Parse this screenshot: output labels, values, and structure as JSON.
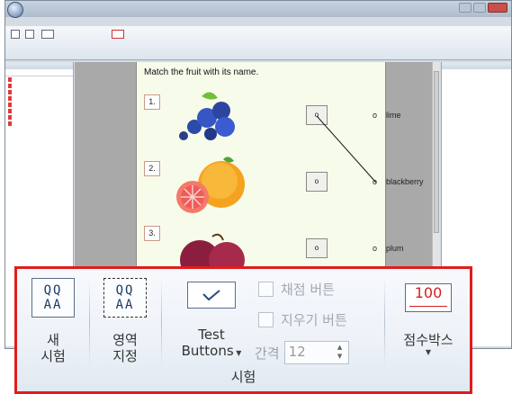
{
  "ribbon_group": {
    "label": "시험",
    "new_exam": {
      "line1": "새",
      "line2": "시험",
      "icon_text": [
        "QQ",
        "AA"
      ]
    },
    "area_select": {
      "line1": "영역",
      "line2": "지정",
      "icon_text": [
        "QQ",
        "AA"
      ]
    },
    "test_buttons": {
      "line1": "Test",
      "line2": "Buttons"
    },
    "grade_button": {
      "label": "채점 버튼"
    },
    "clear_button": {
      "label": "지우기 버튼"
    },
    "spacing": {
      "label": "간격",
      "value": "12"
    },
    "score_box": {
      "label": "점수박스",
      "icon_text": "100"
    }
  },
  "document": {
    "question": "Match the fruit with its name.",
    "items": [
      {
        "number": "1.",
        "answer": "lime"
      },
      {
        "number": "2.",
        "answer": "blackberry"
      },
      {
        "number": "3.",
        "answer": "plum"
      }
    ],
    "dot_marker": "o"
  },
  "colors": {
    "highlight_border": "#e11c1c",
    "score_red": "#d21f1f",
    "page_bg": "#f7fbea"
  }
}
